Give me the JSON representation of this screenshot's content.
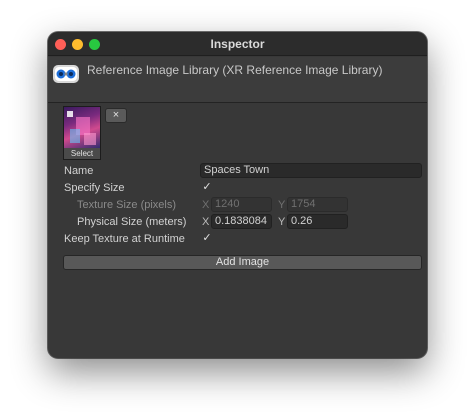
{
  "window": {
    "title": "Inspector"
  },
  "header": {
    "title": "Reference Image Library (XR Reference Image Library)"
  },
  "image_entry": {
    "thumbnail_label": "Select",
    "remove_label": "×",
    "name_label": "Name",
    "name_value": "Spaces Town",
    "specify_size_label": "Specify Size",
    "specify_size_checked": true,
    "texture_size_label": "Texture Size (pixels)",
    "texture_x_label": "X",
    "texture_x_value": "1240",
    "texture_y_label": "Y",
    "texture_y_value": "1754",
    "physical_size_label": "Physical Size (meters)",
    "physical_x_label": "X",
    "physical_x_value": "0.1838084",
    "physical_y_label": "Y",
    "physical_y_value": "0.26",
    "keep_texture_label": "Keep Texture at Runtime",
    "keep_texture_checked": true,
    "check_glyph": "✓"
  },
  "footer": {
    "add_image_label": "Add Image"
  },
  "icons": {
    "asset": "reference-image-library-icon",
    "check": "checkmark-icon"
  }
}
